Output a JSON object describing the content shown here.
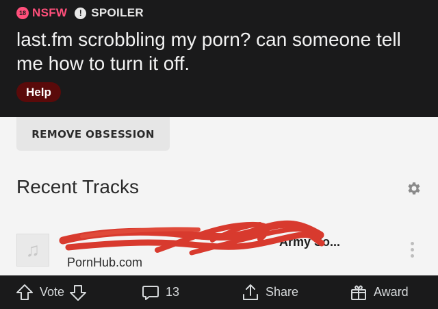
{
  "post": {
    "nsfw_badge_number": "18",
    "nsfw_label": "NSFW",
    "spoiler_badge_glyph": "!",
    "spoiler_label": "SPOILER",
    "title": "last.fm scrobbling my porn? can someone tell me how to turn it off.",
    "flair": "Help",
    "colors": {
      "nsfw": "#ff4f7b",
      "flair_bg": "#5a0a0a",
      "background": "#1a1a1b"
    }
  },
  "embed": {
    "remove_button_label": "REMOVE OBSESSION",
    "section_title": "Recent Tracks",
    "settings_icon": "gear-icon",
    "track": {
      "art_icon": "music-note-icon",
      "art_glyph": "♫",
      "name_visible": "Army So...",
      "artist": "PornHub.com",
      "menu_icon": "more-vertical-icon",
      "redaction_color": "#d83a2e"
    }
  },
  "actions": {
    "vote_label": "Vote",
    "comments_count": "13",
    "share_label": "Share",
    "award_label": "Award"
  }
}
